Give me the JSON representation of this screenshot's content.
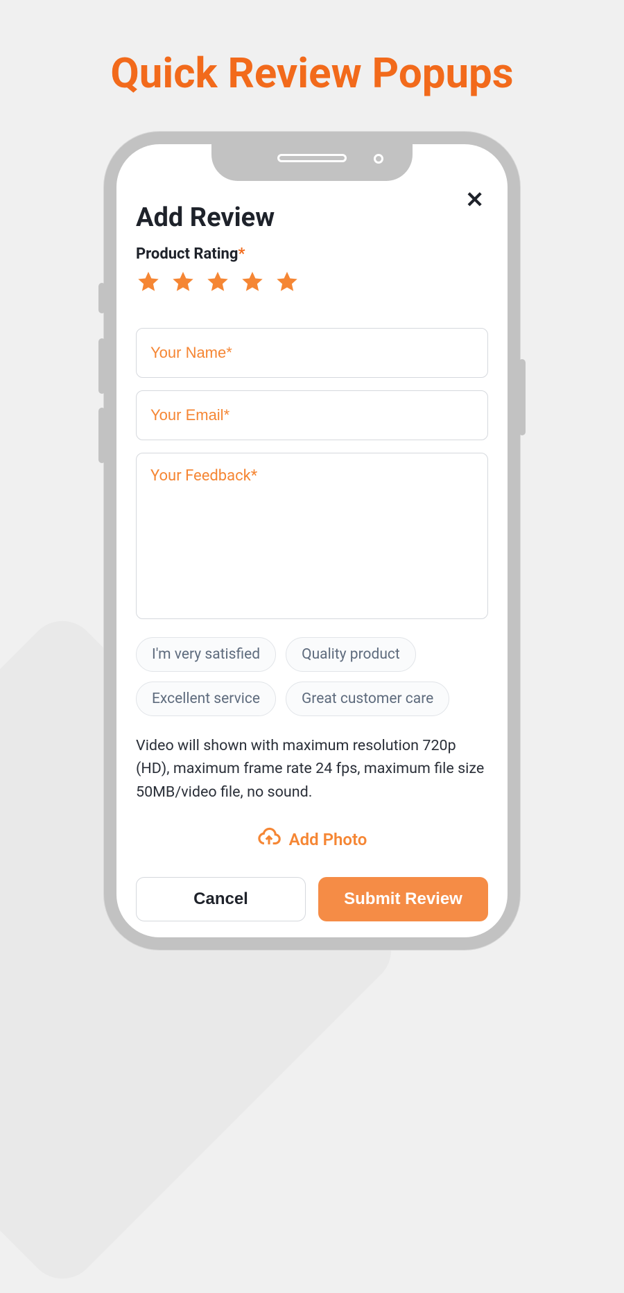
{
  "page": {
    "heading": "Quick Review Popups"
  },
  "colors": {
    "accent": "#f26a1b",
    "star": "#f58634",
    "submit": "#f58c46"
  },
  "form": {
    "close": "✕",
    "title": "Add Review",
    "rating_label": "Product Rating",
    "required_mark": "*",
    "rating_value": 5,
    "fields": {
      "name_placeholder": "Your Name*",
      "email_placeholder": "Your Email*",
      "feedback_placeholder": "Your Feedback*"
    },
    "chips": [
      "I'm very satisfied",
      "Quality product",
      "Excellent service",
      "Great customer care"
    ],
    "note": "Video will shown with maximum resolution 720p (HD), maximum frame rate 24 fps, maximum file size 50MB/video file, no sound.",
    "add_photo_label": "Add Photo",
    "actions": {
      "cancel": "Cancel",
      "submit": "Submit Review"
    }
  }
}
